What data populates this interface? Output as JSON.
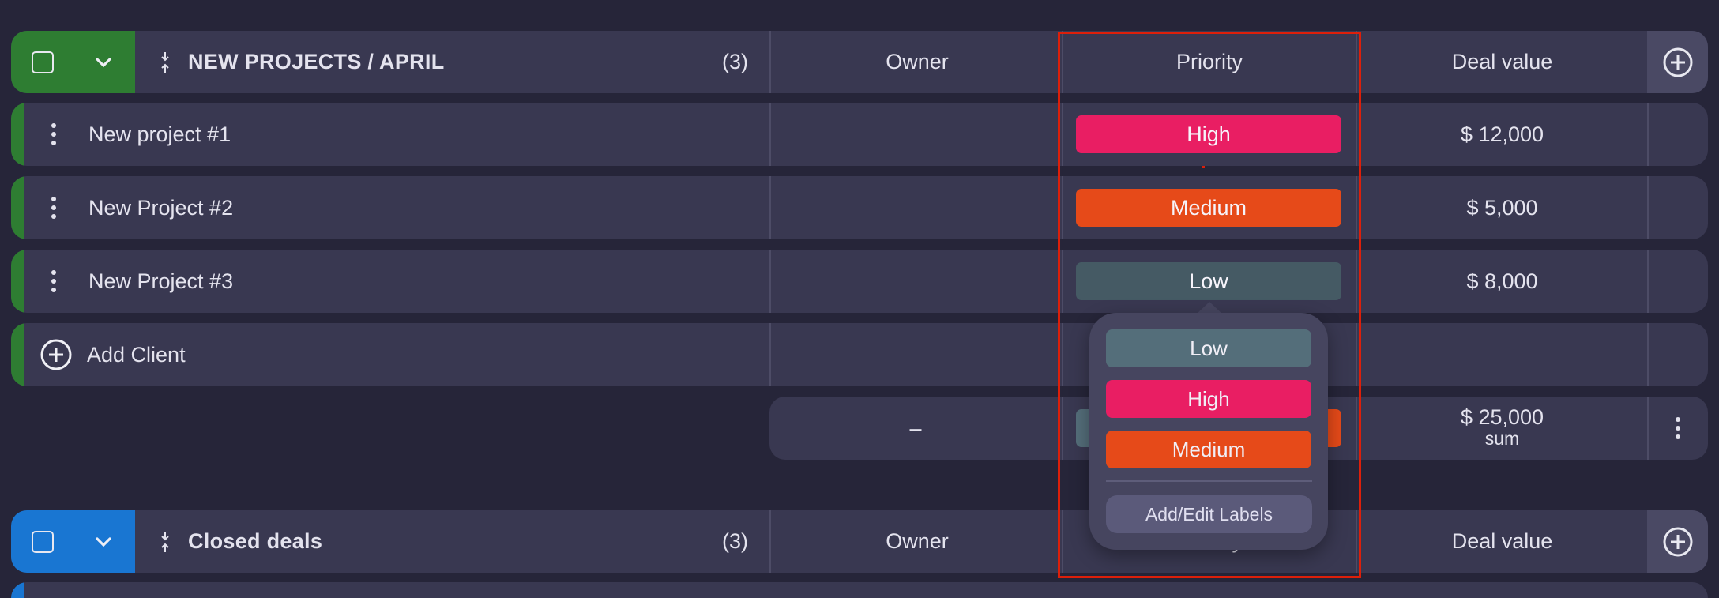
{
  "colors": {
    "background": "#262539",
    "row_bg": "#393851",
    "group1_accent": "#2e7d32",
    "group2_accent": "#1976d2",
    "priority_high": "#e91e63",
    "priority_medium": "#e64a19",
    "priority_low_cell": "#455a64",
    "priority_low_option": "#546e7a",
    "highlight_box": "#dd1f0a"
  },
  "columns": {
    "owner": "Owner",
    "priority": "Priority",
    "deal_value": "Deal value"
  },
  "group1": {
    "title": "NEW PROJECTS / APRIL",
    "count": "(3)",
    "rows": [
      {
        "name": "New project #1",
        "owner": "",
        "priority": "High",
        "deal_value": "$ 12,000"
      },
      {
        "name": "New Project #2",
        "owner": "",
        "priority": "Medium",
        "deal_value": "$ 5,000"
      },
      {
        "name": "New Project #3",
        "owner": "",
        "priority": "Low",
        "deal_value": "$ 8,000"
      }
    ],
    "add_label": "Add Client",
    "summary": {
      "owner": "–",
      "deal_value": "$ 25,000",
      "deal_value_caption": "sum"
    }
  },
  "group2": {
    "title": "Closed deals",
    "count": "(3)"
  },
  "priority_dropdown": {
    "options": [
      "Low",
      "High",
      "Medium"
    ],
    "edit_label": "Add/Edit Labels"
  }
}
